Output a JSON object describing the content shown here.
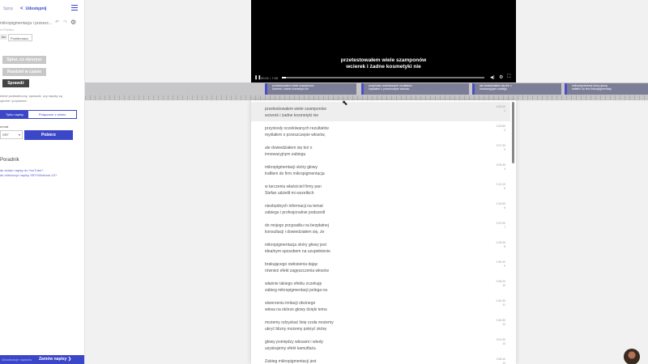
{
  "sidebar": {
    "back_label": "Spisy",
    "share_label": "Udostępnij",
    "title": "mikropigmentacja i przeszc...",
    "subtitle": "rd Polska",
    "tab_a": "8w",
    "tab_b": "Przetłumacz",
    "btn_wysluchaj": "Spisz, co słyszysz",
    "btn_czytelnie": "Rozdziel w czasie",
    "btn_sprawdz": "Sprawdź",
    "desc_line1": "eśnie podświecony, sprawdź, czy napisy są",
    "desc_line2": "ojedne i poprawne.",
    "toggle_a": "Tylko napisy",
    "toggle_b": "Połączone z wideo",
    "format_label": "ormat",
    "format_value": "SRT",
    "download_label": "Pobierz",
    "help_title": "Poradnik",
    "help_link1": "ak dodać napisy do YouTube?",
    "help_link2": "ak odtworzyć napisy SRT/Windows 10?",
    "bottom_left": "Aktualizacje napisów",
    "bottom_right": "Zamów napisy ❯"
  },
  "video": {
    "caption_line1": "przetestowałem wiele szamponów",
    "caption_line2": "wcierek i żadne kosmetyki nie",
    "time": "00:01 / 7:05",
    "progress": 0.02
  },
  "timeline": {
    "segments": [
      {
        "line1": "przetestowałem wiele szamponów",
        "line2": "wcierek i żadne kosmetyki nie"
      },
      {
        "line1": "przyniosły oczekiwanych rezultatów",
        "line2": "myślałem o przeszczepie włosów,"
      },
      {
        "line1": "ale dowiedziałem się też o",
        "line2": "innowacyjnym zabiegu"
      },
      {
        "line1": "mikropigmentacji skóry głowy",
        "line2": "trafiłem do firm mikropigmentacji"
      }
    ]
  },
  "transcript": [
    {
      "line1": "przetestowałem wiele szamponów",
      "line2": "wcierek i żadne kosmetyki nie",
      "start": "0:00:00",
      "idx": "1",
      "active": true
    },
    {
      "line1": "przyniosły oczekiwanych rezultatów",
      "line2": "myślałem o przeszczepie włosów,",
      "start": "0:03:60",
      "idx": "2",
      "active": false
    },
    {
      "line1": "ale dowiedziałem się też o",
      "line2": "innowacyjnym zabiegu",
      "start": "0:07:30",
      "idx": "3",
      "active": false
    },
    {
      "line1": "mikropigmentacji skóry głowy",
      "line2": "trafiłem do firm mikropigmentacja",
      "start": "0:09:35",
      "idx": "4",
      "active": false
    },
    {
      "line1": "w tarczeniu właściciel firmy pan",
      "line2": "Stefan udzielił mi wszelkich",
      "start": "0:13:15",
      "idx": "5",
      "active": false
    },
    {
      "line1": "niezbędnych informacji na temat",
      "line2": "zabiegu i profesjonalnie podszedł",
      "start": "0:15:55",
      "idx": "6",
      "active": false
    },
    {
      "line1": "do mojego przypadku na bezpłatnej",
      "line2": "konsultacji i dowiedziałem się, że",
      "start": "0:22:30",
      "idx": "7",
      "active": false
    },
    {
      "line1": "mikropigmentacja skóry głowy jest",
      "line2": "idealnym sposobem na uzupełnienie",
      "start": "0:25:45",
      "idx": "8",
      "active": false
    },
    {
      "line1": "brakującego owłosienia dając",
      "line2": "również efekt zagęszczenia włosów",
      "start": "0:30:40",
      "idx": "9",
      "active": false
    },
    {
      "line1": "właśnie takiego efektu oczekuję",
      "line2": "zabieg mikropigmentacji polega na",
      "start": "0:35:20",
      "idx": "10",
      "active": false
    },
    {
      "line1": "stworzeniu imitacji obcinego",
      "line2": "włosa na skórze głowy dzięki temu",
      "start": "0:40:35",
      "idx": "11",
      "active": false
    },
    {
      "line1": "możemy odzyskać linię czoła możemy",
      "line2": "ukryć blizny możemy pokryć skórę",
      "start": "0:46:30",
      "idx": "12",
      "active": false
    },
    {
      "line1": "głowy pomiędzy włosami i wtedy",
      "line2": "uzyskujemy efekt kamuflażu.",
      "start": "0:51:30",
      "idx": "13",
      "active": false
    },
    {
      "line1": "Zabieg mikropigmentacji jest",
      "line2": "",
      "start": "0:56:40",
      "idx": "14",
      "active": false
    }
  ],
  "colors": {
    "accent": "#3c46c8",
    "timeline_segment": "#7c7d96",
    "video_bg": "#000000"
  }
}
